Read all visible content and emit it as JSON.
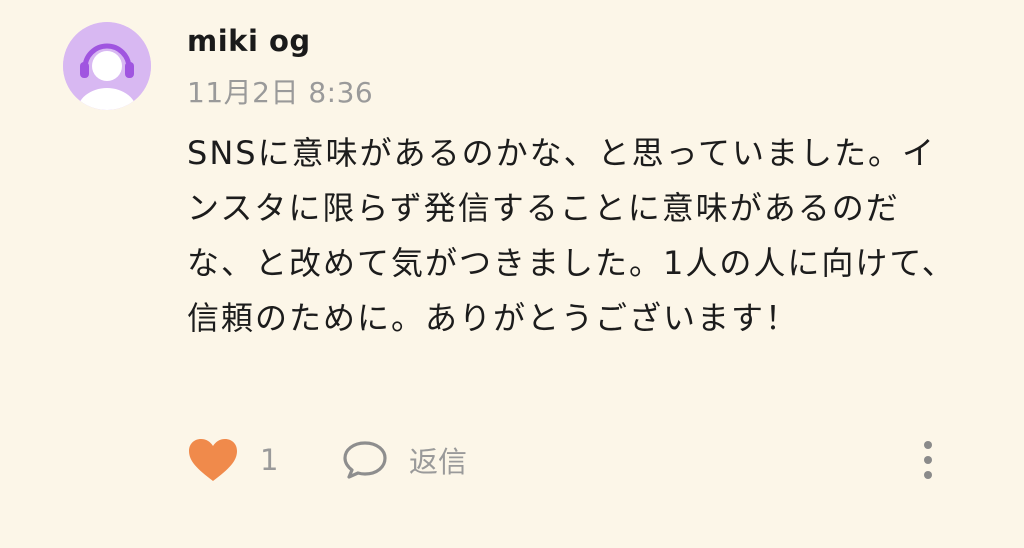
{
  "comment": {
    "username": "miki og",
    "timestamp": "11月2日 8:36",
    "body": "SNSに意味があるのかな、と思っていました。インスタに限らず発信することに意味があるのだな、と改めて気がつきました。1人の人に向けて、信頼のために。ありがとうございます！",
    "like_count": "1",
    "reply_label": "返信",
    "liked": true
  },
  "icons": {
    "avatar": "user-avatar-with-headphones-icon",
    "like": "heart-icon",
    "reply": "speech-bubble-icon",
    "more": "vertical-ellipsis-icon"
  },
  "colors": {
    "background": "#fcf6e8",
    "heart": "#f08a4b",
    "avatar_bg": "#d8b8f2",
    "avatar_accent": "#a055e0",
    "muted_text": "#9a9a9a"
  }
}
